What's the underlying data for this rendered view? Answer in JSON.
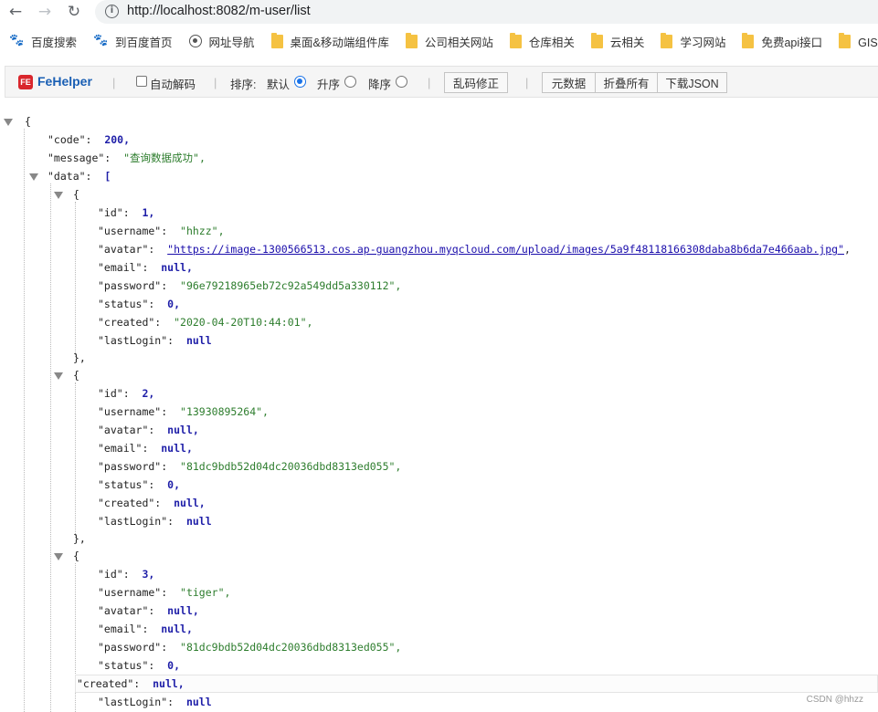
{
  "browser": {
    "url": "http://localhost:8082/m-user/list",
    "back_icon": "back-arrow-icon",
    "forward_icon": "forward-arrow-icon",
    "reload_icon": "reload-icon"
  },
  "bookmarks": [
    {
      "label": "百度搜索",
      "icon": "paw-icon"
    },
    {
      "label": "到百度首页",
      "icon": "paw-icon"
    },
    {
      "label": "网址导航",
      "icon": "globe-icon"
    },
    {
      "label": "桌面&移动端组件库",
      "icon": "folder-icon"
    },
    {
      "label": "公司相关网站",
      "icon": "folder-icon"
    },
    {
      "label": "仓库相关",
      "icon": "folder-icon"
    },
    {
      "label": "云相关",
      "icon": "folder-icon"
    },
    {
      "label": "学习网站",
      "icon": "folder-icon"
    },
    {
      "label": "免费api接口",
      "icon": "folder-icon"
    },
    {
      "label": "GIS相关",
      "icon": "folder-icon"
    }
  ],
  "fehelper": {
    "logo": "FE",
    "title": "FeHelper",
    "auto_decode": "自动解码",
    "sort_label": "排序:",
    "sort_default": "默认",
    "sort_asc": "升序",
    "sort_desc": "降序",
    "fix_garbled": "乱码修正",
    "raw_data": "元数据",
    "collapse_all": "折叠所有",
    "download_json": "下载JSON"
  },
  "json": {
    "open_brace": "{",
    "code_key": "\"code\":",
    "code_val": "200,",
    "message_key": "\"message\":",
    "message_val": "\"查询数据成功\",",
    "data_key": "\"data\":",
    "data_open": "[",
    "records": [
      {
        "id": "1,",
        "username": "\"hhzz\",",
        "avatar": "\"https://image-1300566513.cos.ap-guangzhou.myqcloud.com/upload/images/5a9f48118166308daba8b6da7e466aab.jpg\"",
        "avatar_suffix": ",",
        "email": "null,",
        "password": "\"96e79218965eb72c92a549dd5a330112\",",
        "status": "0,",
        "created": "\"2020-04-20T10:44:01\",",
        "lastLogin": "null"
      },
      {
        "id": "2,",
        "username": "\"13930895264\",",
        "avatar": "null,",
        "email": "null,",
        "password": "\"81dc9bdb52d04dc20036dbd8313ed055\",",
        "status": "0,",
        "created": "null,",
        "lastLogin": "null"
      },
      {
        "id": "3,",
        "username": "\"tiger\",",
        "avatar": "null,",
        "email": "null,",
        "password": "\"81dc9bdb52d04dc20036dbd8313ed055\",",
        "status": "0,",
        "created": "null,",
        "lastLogin": "null"
      }
    ],
    "keys": {
      "id": "\"id\":",
      "username": "\"username\":",
      "avatar": "\"avatar\":",
      "email": "\"email\":",
      "password": "\"password\":",
      "status": "\"status\":",
      "created": "\"created\":",
      "lastLogin": "\"lastLogin\":"
    },
    "obj_open": "{",
    "obj_close": "},"
  },
  "watermark": "CSDN @hhzz"
}
